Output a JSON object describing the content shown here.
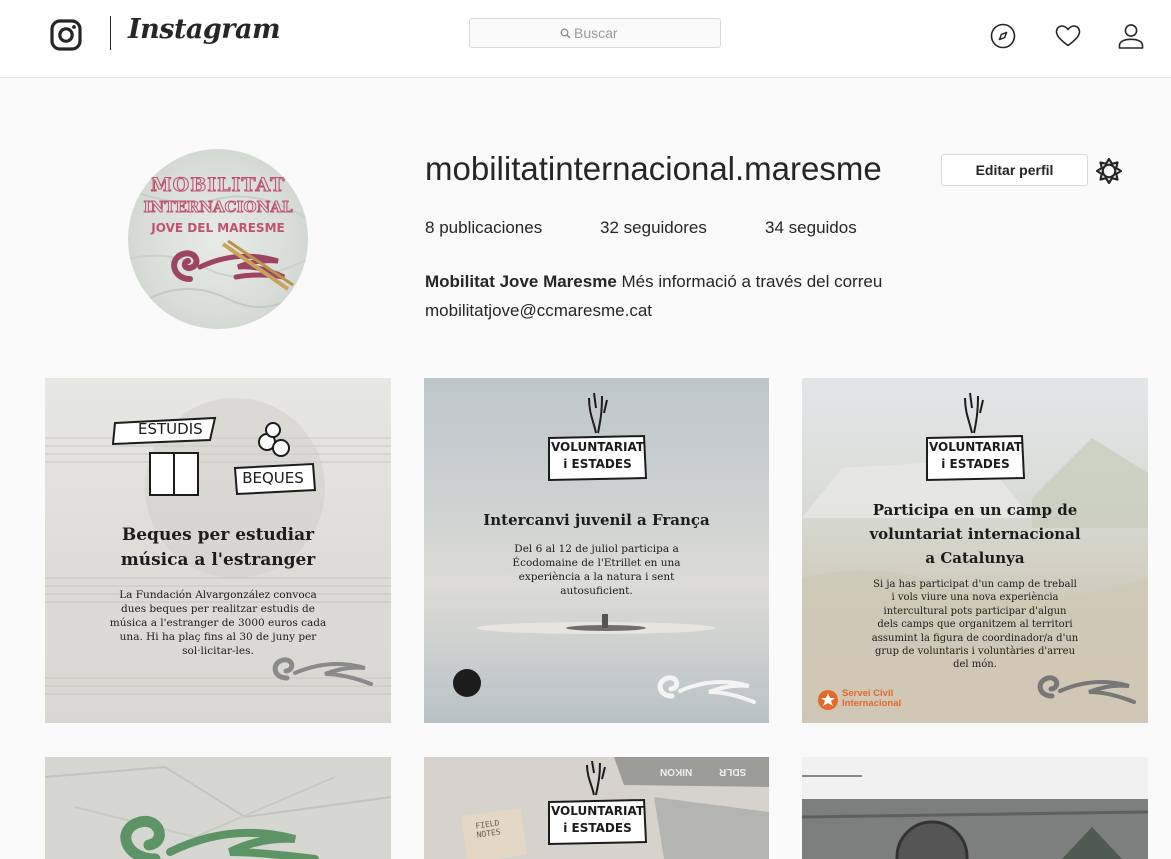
{
  "header": {
    "wordmark": "Instagram",
    "search_placeholder": "Buscar",
    "icons": [
      "instagram-logo-icon",
      "compass-icon",
      "heart-icon",
      "person-icon"
    ]
  },
  "profile": {
    "username": "mobilitatinternacional.maresme",
    "edit_label": "Editar perfil",
    "stats": {
      "posts_count": "8",
      "posts_label": "publicaciones",
      "followers_count": "32",
      "followers_label": "seguidores",
      "following_count": "34",
      "following_label": "seguidos"
    },
    "bio_name": "Mobilitat Jove Maresme",
    "bio_text": "Més informació a través del correu",
    "bio_email": "mobilitatjove@ccmaresme.cat",
    "avatar": {
      "line1": "MOBILITAT",
      "line2": "INTERNACIONAL",
      "line3": "JOVE DEL MARESME"
    }
  },
  "posts": [
    {
      "tag1": "ESTUDIS",
      "tag2": "BEQUES",
      "title_line1": "Beques per estudiar",
      "title_line2": "música a l'estranger",
      "body": [
        "La Fundación Alvargonzález convoca",
        "dues beques per  realitzar estudis de",
        "música  a l'estranger de 3000 euros cada",
        "una. Hi ha plaç fins al 30 de juny per",
        "sol·licitar-les."
      ]
    },
    {
      "tag1": "VOLUNTARIAT",
      "tag2": "i ESTADES",
      "title_line1": "Intercanvi juvenil a França",
      "body": [
        "Del 6 al 12 de juliol participa a",
        "Écodomaine de l'Etrillet en una",
        "experiència a la natura i sent",
        "autosuficient."
      ]
    },
    {
      "tag1": "VOLUNTARIAT",
      "tag2": "i ESTADES",
      "title_line1": "Participa en un camp de",
      "title_line2": "voluntariat internacional",
      "title_line3": "a Catalunya",
      "body": [
        "Si ja has participat d'un camp de treball",
        "i vols viure una nova experiència",
        "intercultural pots participar d'algun",
        "dels camps que organitzem al territori",
        "assumint la figura de coordinador/a d'un",
        "grup de voluntaris i voluntàries d'arreu",
        "del món."
      ],
      "org_line1": "Servei Civil",
      "org_line2": "Internacional"
    },
    {},
    {
      "tag1": "VOLUNTARIAT",
      "tag2": "i ESTADES",
      "notebook_line1": "FIELD",
      "notebook_line2": "NOTES",
      "camera_text1": "NIKON",
      "camera_text2": "SDLR"
    },
    {}
  ],
  "colors": {
    "accent_text": "#262626",
    "border": "#dbdbdb",
    "avatar_text": "#c0546f",
    "swirl": "#9d4463",
    "sci_orange": "#e8682a"
  }
}
